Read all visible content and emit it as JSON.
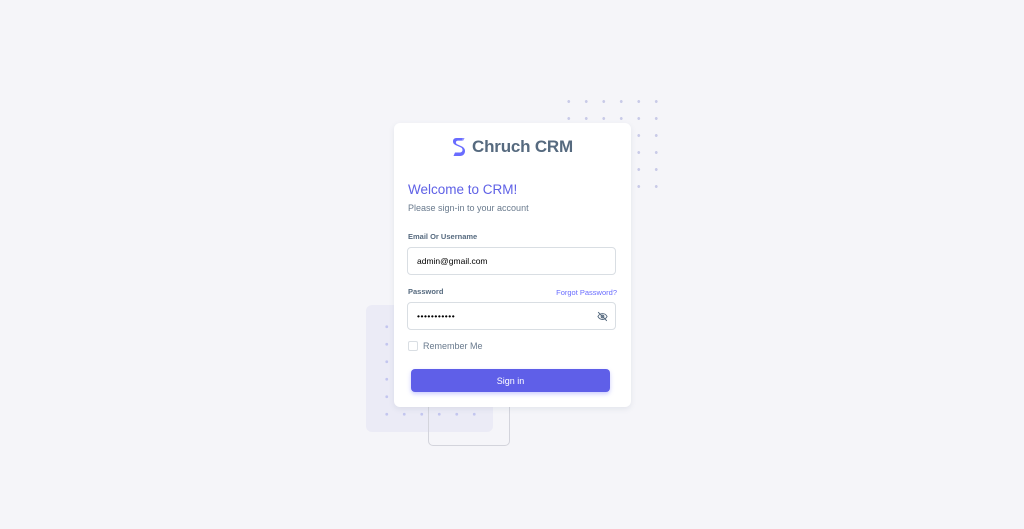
{
  "brand": {
    "name": "Chruch CRM",
    "logo_icon": "s-logo-icon",
    "logo_color": "#696cff"
  },
  "welcome": {
    "title": "Welcome to CRM!",
    "subtitle": "Please sign-in to your account"
  },
  "form": {
    "email_label": "Email Or Username",
    "email_value": "admin@gmail.com",
    "password_label": "Password",
    "password_value": "•••••••••••",
    "forgot_label": "Forgot Password?",
    "toggle_icon": "eye-off-icon",
    "remember_label": "Remember Me",
    "remember_checked": false,
    "signin_label": "Sign in"
  },
  "colors": {
    "primary": "#696cff",
    "background": "#f5f5f9",
    "heading": "#566a7f",
    "muted": "#697a8d"
  }
}
